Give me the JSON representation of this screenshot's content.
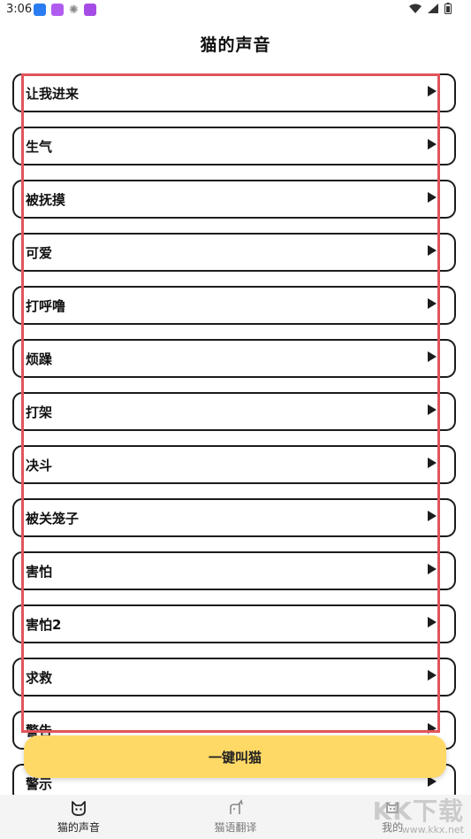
{
  "status_bar": {
    "time": "3:06"
  },
  "page_title": "猫的声音",
  "sounds": [
    "让我进来",
    "生气",
    "被抚摸",
    "可爱",
    "打呼噜",
    "烦躁",
    "打架",
    "决斗",
    "被关笼子",
    "害怕",
    "害怕2",
    "求救",
    "警告",
    "警示"
  ],
  "call_button": "一键叫猫",
  "nav": {
    "items": [
      {
        "label": "猫的声音",
        "icon": "cat-face-icon",
        "active": true
      },
      {
        "label": "猫语翻译",
        "icon": "cat-translate-icon",
        "active": false
      },
      {
        "label": "我的",
        "icon": "profile-icon",
        "active": false
      }
    ]
  },
  "watermark": {
    "text": "KK下载",
    "url_text": "www.kkx.net"
  },
  "colors": {
    "accent_button": "#ffd966",
    "highlight_box": "#e0555b",
    "border": "#1c1c1c"
  }
}
